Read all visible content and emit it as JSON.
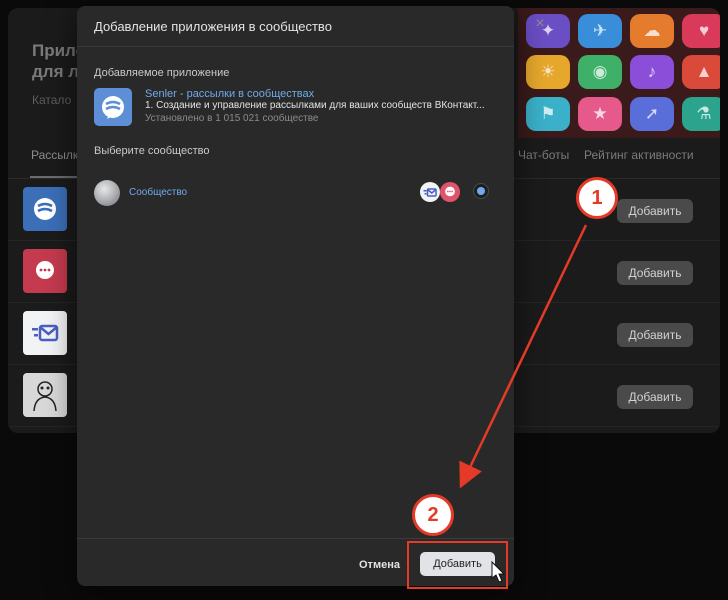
{
  "background": {
    "title_line1": "Прило",
    "title_line2": "для л",
    "catalog": "Катало",
    "tabs": [
      "Рассылк",
      "Чат-боты",
      "Рейтинг активности"
    ],
    "add_label": "Добавить"
  },
  "modal": {
    "title": "Добавление приложения в сообщество",
    "close": "×",
    "app_section_label": "Добавляемое приложение",
    "app": {
      "name": "Senler - рассылки в сообществах",
      "description": "1. Создание и управление рассылками для ваших сообществ ВКонтакт...",
      "installs": "Установлено в 1 015 021 сообществе"
    },
    "community_section_label": "Выберите сообщество",
    "community": {
      "name": "Сообщество"
    },
    "cancel_label": "Отмена",
    "submit_label": "Добавить"
  },
  "annotations": {
    "step1": "1",
    "step2": "2"
  },
  "colors": {
    "accent": "#71aaeb",
    "annotation_red": "#e53a28",
    "modal_bg": "#292929"
  }
}
